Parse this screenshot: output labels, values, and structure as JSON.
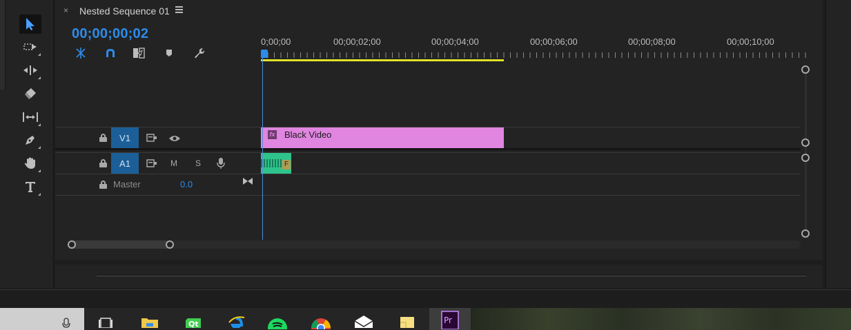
{
  "panel": {
    "close_glyph": "×",
    "tab_title": "Nested Sequence 01",
    "timecode": "00;00;00;02"
  },
  "ruler": {
    "labels": [
      "0;00;00",
      "00;00;02;00",
      "00;00;04;00",
      "00;00;06;00",
      "00;00;08;00",
      "00;00;10;00"
    ]
  },
  "tracks": {
    "v1": {
      "target": "V1"
    },
    "a1": {
      "target": "A1",
      "mute": "M",
      "solo": "S"
    },
    "master": {
      "label": "Master",
      "value": "0.0"
    }
  },
  "clips": {
    "video": {
      "fx": "fx",
      "name": "Black Video"
    },
    "audio": {
      "badge": "F"
    }
  },
  "tools": [
    "selection-tool",
    "track-select-tool",
    "ripple-edit-tool",
    "razor-tool",
    "slip-tool",
    "pen-tool",
    "hand-tool",
    "type-tool"
  ],
  "taskbar": {
    "apps": [
      "task-view",
      "file-explorer",
      "qt-creator",
      "internet-explorer",
      "spotify",
      "chrome",
      "mail",
      "sticky-notes",
      "premiere-pro"
    ],
    "premiere_label": "Pr",
    "qt_label": "Qt"
  },
  "colors": {
    "accent_blue": "#2d8ceb",
    "video_clip": "#e085e0",
    "audio_clip": "#2ec48c",
    "work_area": "#e3e32a"
  }
}
